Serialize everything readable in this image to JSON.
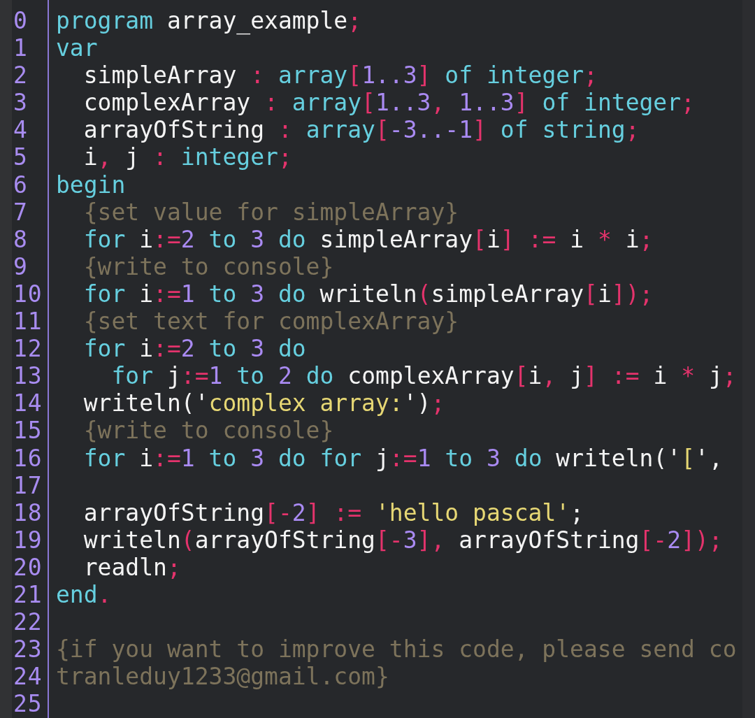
{
  "editor": {
    "lines": [
      {
        "number": "0",
        "tokens": [
          {
            "text": "program",
            "kind": "keyword"
          },
          {
            "text": " array_example",
            "kind": "plain"
          },
          {
            "text": ";",
            "kind": "symbol"
          }
        ]
      },
      {
        "number": "1",
        "tokens": [
          {
            "text": "var",
            "kind": "keyword"
          }
        ]
      },
      {
        "number": "2",
        "tokens": [
          {
            "text": "  simpleArray ",
            "kind": "plain"
          },
          {
            "text": ":",
            "kind": "symbol"
          },
          {
            "text": " array",
            "kind": "keyword"
          },
          {
            "text": "[",
            "kind": "symbol"
          },
          {
            "text": "1..3",
            "kind": "number"
          },
          {
            "text": "]",
            "kind": "symbol"
          },
          {
            "text": " of integer",
            "kind": "keyword"
          },
          {
            "text": ";",
            "kind": "symbol"
          }
        ]
      },
      {
        "number": "3",
        "tokens": [
          {
            "text": "  complexArray ",
            "kind": "plain"
          },
          {
            "text": ":",
            "kind": "symbol"
          },
          {
            "text": " array",
            "kind": "keyword"
          },
          {
            "text": "[",
            "kind": "symbol"
          },
          {
            "text": "1..3",
            "kind": "number"
          },
          {
            "text": ",",
            "kind": "symbol"
          },
          {
            "text": " 1..3",
            "kind": "number"
          },
          {
            "text": "]",
            "kind": "symbol"
          },
          {
            "text": " of integer",
            "kind": "keyword"
          },
          {
            "text": ";",
            "kind": "symbol"
          }
        ]
      },
      {
        "number": "4",
        "tokens": [
          {
            "text": "  arrayOfString ",
            "kind": "plain"
          },
          {
            "text": ":",
            "kind": "symbol"
          },
          {
            "text": " array",
            "kind": "keyword"
          },
          {
            "text": "[",
            "kind": "symbol"
          },
          {
            "text": "-3..-1",
            "kind": "number"
          },
          {
            "text": "]",
            "kind": "symbol"
          },
          {
            "text": " of string",
            "kind": "keyword"
          },
          {
            "text": ";",
            "kind": "symbol"
          }
        ]
      },
      {
        "number": "5",
        "tokens": [
          {
            "text": "  i",
            "kind": "plain"
          },
          {
            "text": ",",
            "kind": "symbol"
          },
          {
            "text": " j ",
            "kind": "plain"
          },
          {
            "text": ":",
            "kind": "symbol"
          },
          {
            "text": " integer",
            "kind": "keyword"
          },
          {
            "text": ";",
            "kind": "symbol"
          }
        ]
      },
      {
        "number": "6",
        "tokens": [
          {
            "text": "begin",
            "kind": "keyword"
          }
        ]
      },
      {
        "number": "7",
        "tokens": [
          {
            "text": "  {set value for simpleArray}",
            "kind": "comment"
          }
        ]
      },
      {
        "number": "8",
        "tokens": [
          {
            "text": "  for",
            "kind": "keyword"
          },
          {
            "text": " i",
            "kind": "plain"
          },
          {
            "text": ":=",
            "kind": "symbol"
          },
          {
            "text": "2",
            "kind": "number"
          },
          {
            "text": " to",
            "kind": "keyword"
          },
          {
            "text": " 3",
            "kind": "number"
          },
          {
            "text": " do",
            "kind": "keyword"
          },
          {
            "text": " simpleArray",
            "kind": "plain"
          },
          {
            "text": "[",
            "kind": "symbol"
          },
          {
            "text": "i",
            "kind": "plain"
          },
          {
            "text": "]",
            "kind": "symbol"
          },
          {
            "text": " :=",
            "kind": "symbol"
          },
          {
            "text": " i ",
            "kind": "plain"
          },
          {
            "text": "*",
            "kind": "symbol"
          },
          {
            "text": " i",
            "kind": "plain"
          },
          {
            "text": ";",
            "kind": "symbol"
          }
        ]
      },
      {
        "number": "9",
        "tokens": [
          {
            "text": "  {write to console}",
            "kind": "comment"
          }
        ]
      },
      {
        "number": "10",
        "tokens": [
          {
            "text": "  for",
            "kind": "keyword"
          },
          {
            "text": " i",
            "kind": "plain"
          },
          {
            "text": ":=",
            "kind": "symbol"
          },
          {
            "text": "1",
            "kind": "number"
          },
          {
            "text": " to",
            "kind": "keyword"
          },
          {
            "text": " 3",
            "kind": "number"
          },
          {
            "text": " do",
            "kind": "keyword"
          },
          {
            "text": " writeln",
            "kind": "plain"
          },
          {
            "text": "(",
            "kind": "symbol"
          },
          {
            "text": "simpleArray",
            "kind": "plain"
          },
          {
            "text": "[",
            "kind": "symbol"
          },
          {
            "text": "i",
            "kind": "plain"
          },
          {
            "text": "]);",
            "kind": "symbol"
          }
        ]
      },
      {
        "number": "11",
        "tokens": [
          {
            "text": "  {set text for complexArray}",
            "kind": "comment"
          }
        ]
      },
      {
        "number": "12",
        "tokens": [
          {
            "text": "  for",
            "kind": "keyword"
          },
          {
            "text": " i",
            "kind": "plain"
          },
          {
            "text": ":=",
            "kind": "symbol"
          },
          {
            "text": "2",
            "kind": "number"
          },
          {
            "text": " to",
            "kind": "keyword"
          },
          {
            "text": " 3",
            "kind": "number"
          },
          {
            "text": " do",
            "kind": "keyword"
          }
        ]
      },
      {
        "number": "13",
        "tokens": [
          {
            "text": "    for",
            "kind": "keyword"
          },
          {
            "text": " j",
            "kind": "plain"
          },
          {
            "text": ":=",
            "kind": "symbol"
          },
          {
            "text": "1",
            "kind": "number"
          },
          {
            "text": " to",
            "kind": "keyword"
          },
          {
            "text": " 2",
            "kind": "number"
          },
          {
            "text": " do",
            "kind": "keyword"
          },
          {
            "text": " complexArray",
            "kind": "plain"
          },
          {
            "text": "[",
            "kind": "symbol"
          },
          {
            "text": "i",
            "kind": "plain"
          },
          {
            "text": ",",
            "kind": "symbol"
          },
          {
            "text": " j",
            "kind": "plain"
          },
          {
            "text": "]",
            "kind": "symbol"
          },
          {
            "text": " :=",
            "kind": "symbol"
          },
          {
            "text": " i ",
            "kind": "plain"
          },
          {
            "text": "*",
            "kind": "symbol"
          },
          {
            "text": " j",
            "kind": "plain"
          },
          {
            "text": ";",
            "kind": "symbol"
          }
        ]
      },
      {
        "number": "14",
        "tokens": [
          {
            "text": "  writeln('",
            "kind": "plain"
          },
          {
            "text": "complex array:",
            "kind": "string"
          },
          {
            "text": "')",
            "kind": "plain"
          },
          {
            "text": ";",
            "kind": "symbol"
          }
        ]
      },
      {
        "number": "15",
        "tokens": [
          {
            "text": "  {write to console}",
            "kind": "comment"
          }
        ]
      },
      {
        "number": "16",
        "tokens": [
          {
            "text": "  for",
            "kind": "keyword"
          },
          {
            "text": " i",
            "kind": "plain"
          },
          {
            "text": ":=",
            "kind": "symbol"
          },
          {
            "text": "1",
            "kind": "number"
          },
          {
            "text": " to",
            "kind": "keyword"
          },
          {
            "text": " 3",
            "kind": "number"
          },
          {
            "text": " do for",
            "kind": "keyword"
          },
          {
            "text": " j",
            "kind": "plain"
          },
          {
            "text": ":=",
            "kind": "symbol"
          },
          {
            "text": "1",
            "kind": "number"
          },
          {
            "text": " to",
            "kind": "keyword"
          },
          {
            "text": " 3",
            "kind": "number"
          },
          {
            "text": " do",
            "kind": "keyword"
          },
          {
            "text": " writeln('",
            "kind": "plain"
          },
          {
            "text": "[",
            "kind": "string"
          },
          {
            "text": "',",
            "kind": "plain"
          }
        ]
      },
      {
        "number": "17"
      },
      {
        "number": "18",
        "tokens": [
          {
            "text": "  arrayOfString",
            "kind": "plain"
          },
          {
            "text": "[-",
            "kind": "symbol"
          },
          {
            "text": "2",
            "kind": "number"
          },
          {
            "text": "]",
            "kind": "symbol"
          },
          {
            "text": " :=",
            "kind": "symbol"
          },
          {
            "text": " 'hello pascal'",
            "kind": "string"
          },
          {
            "text": ";",
            "kind": "plain"
          }
        ]
      },
      {
        "number": "19",
        "tokens": [
          {
            "text": "  writeln",
            "kind": "plain"
          },
          {
            "text": "(",
            "kind": "symbol"
          },
          {
            "text": "arrayOfString",
            "kind": "plain"
          },
          {
            "text": "[-",
            "kind": "symbol"
          },
          {
            "text": "3",
            "kind": "number"
          },
          {
            "text": "],",
            "kind": "symbol"
          },
          {
            "text": " arrayOfString",
            "kind": "plain"
          },
          {
            "text": "[-",
            "kind": "symbol"
          },
          {
            "text": "2",
            "kind": "number"
          },
          {
            "text": "]);",
            "kind": "symbol"
          }
        ]
      },
      {
        "number": "20",
        "tokens": [
          {
            "text": "  readln",
            "kind": "plain"
          },
          {
            "text": ";",
            "kind": "symbol"
          }
        ]
      },
      {
        "number": "21",
        "tokens": [
          {
            "text": "end",
            "kind": "keyword"
          },
          {
            "text": ".",
            "kind": "symbol"
          }
        ]
      },
      {
        "number": "22"
      },
      {
        "number": "23",
        "tokens": [
          {
            "text": "{if you want to improve this code, please send co",
            "kind": "comment"
          }
        ]
      },
      {
        "number": "24",
        "tokens": [
          {
            "text": "tranleduy1233@gmail.com}",
            "kind": "comment"
          }
        ]
      },
      {
        "number": "25"
      }
    ]
  }
}
